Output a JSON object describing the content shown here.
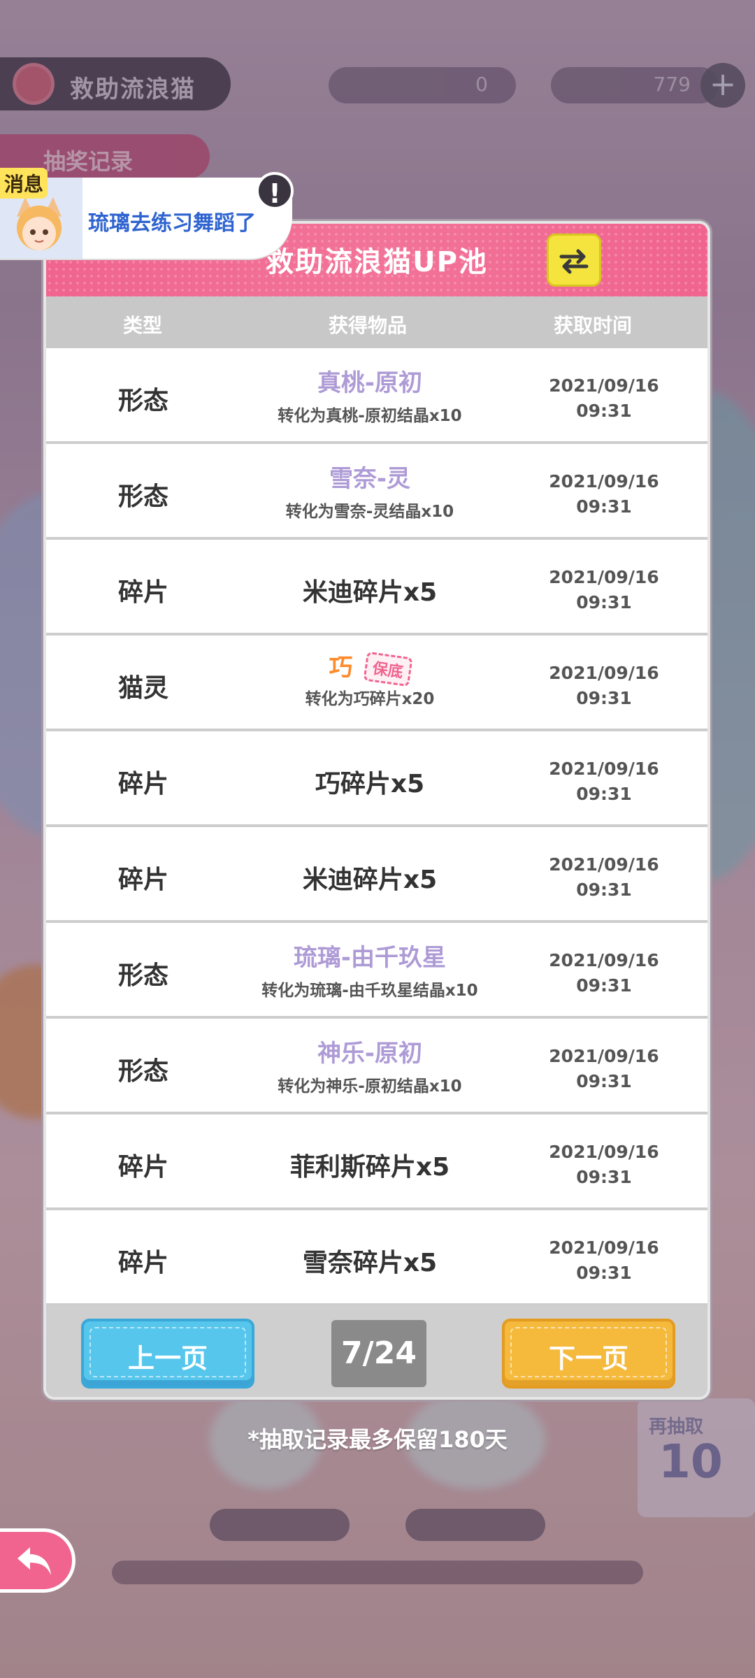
{
  "hud": {
    "event_name": "救助流浪猫",
    "resource_1": "0",
    "resource_2": "779",
    "record_tab": "抽奖记录"
  },
  "toast": {
    "tag": "消息",
    "text": "琉璃去练习舞蹈了",
    "alert": "!"
  },
  "panel": {
    "title": "救助流浪猫UP池",
    "columns": [
      "类型",
      "获得物品",
      "获取时间"
    ],
    "rows": [
      {
        "type": "形态",
        "item": "真桃-原初",
        "sub": "转化为真桃-原初结晶x10",
        "date": "2021/09/16",
        "time": "09:31"
      },
      {
        "type": "形态",
        "item": "雪奈-灵",
        "sub": "转化为雪奈-灵结晶x10",
        "date": "2021/09/16",
        "time": "09:31"
      },
      {
        "type": "碎片",
        "item": "米迪碎片x5",
        "sub": "",
        "date": "2021/09/16",
        "time": "09:31"
      },
      {
        "type": "猫灵",
        "item": "巧",
        "badge": "保底",
        "sub": "转化为巧碎片x20",
        "date": "2021/09/16",
        "time": "09:31"
      },
      {
        "type": "碎片",
        "item": "巧碎片x5",
        "sub": "",
        "date": "2021/09/16",
        "time": "09:31"
      },
      {
        "type": "碎片",
        "item": "米迪碎片x5",
        "sub": "",
        "date": "2021/09/16",
        "time": "09:31"
      },
      {
        "type": "形态",
        "item": "琉璃-由千玖星",
        "sub": "转化为琉璃-由千玖星结晶x10",
        "date": "2021/09/16",
        "time": "09:31"
      },
      {
        "type": "形态",
        "item": "神乐-原初",
        "sub": "转化为神乐-原初结晶x10",
        "date": "2021/09/16",
        "time": "09:31"
      },
      {
        "type": "碎片",
        "item": "菲利斯碎片x5",
        "sub": "",
        "date": "2021/09/16",
        "time": "09:31"
      },
      {
        "type": "碎片",
        "item": "雪奈碎片x5",
        "sub": "",
        "date": "2021/09/16",
        "time": "09:31"
      }
    ],
    "prev_label": "上一页",
    "next_label": "下一页",
    "page_indicator": "7/24"
  },
  "note": "*抽取记录最多保留180天",
  "bg_card": {
    "title": "再抽取",
    "number": "10"
  },
  "colors": {
    "header_pink": "#f0648f",
    "purple_item": "#ae9bd6",
    "prev_blue": "#56c6ec",
    "next_orange": "#f5b93b",
    "swap_yellow": "#f4e43d"
  },
  "icons": {
    "swap": "swap-arrows-icon",
    "back": "back-arrow-icon",
    "alert": "exclamation-icon"
  }
}
